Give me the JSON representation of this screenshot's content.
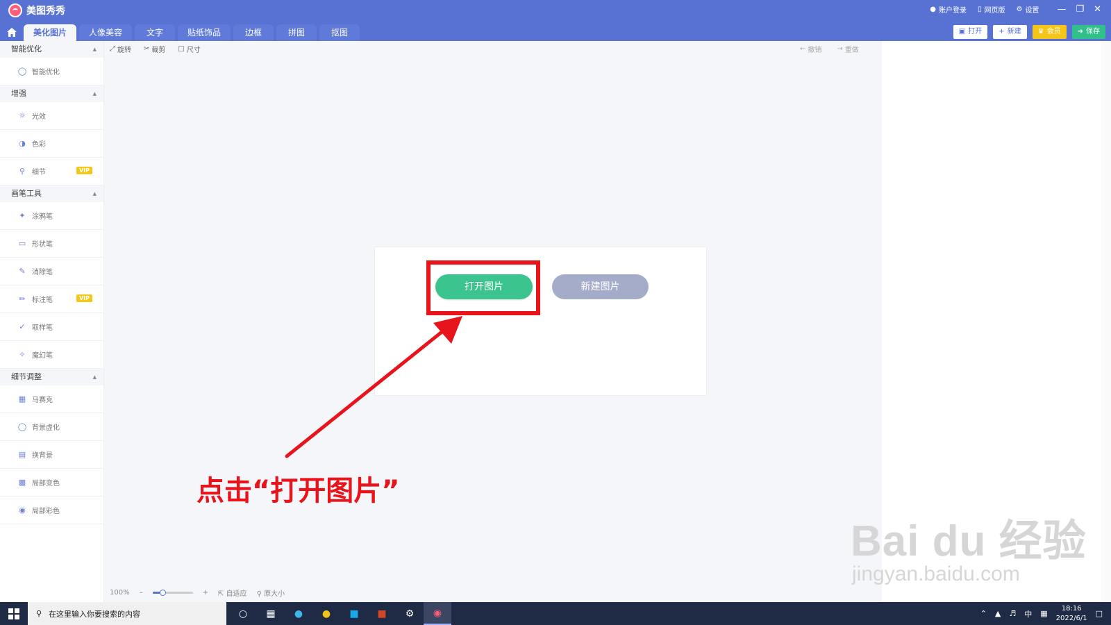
{
  "app": {
    "title": "美图秀秀"
  },
  "top_right": {
    "login": "账户登录",
    "web": "网页版",
    "settings": "设置"
  },
  "tabs": [
    "美化图片",
    "人像美容",
    "文字",
    "贴纸饰品",
    "边框",
    "拼图",
    "抠图"
  ],
  "actions": {
    "open": "打开",
    "new": "新建",
    "vip": "会员",
    "save": "保存"
  },
  "sidebar": {
    "groups": [
      {
        "title": "智能优化",
        "items": [
          {
            "label": "智能优化",
            "icon": "bulb-icon"
          }
        ]
      },
      {
        "title": "增强",
        "items": [
          {
            "label": "光效",
            "icon": "sun-icon"
          },
          {
            "label": "色彩",
            "icon": "palette-icon"
          },
          {
            "label": "细节",
            "icon": "magnifier-icon",
            "badge": "VIP"
          }
        ]
      },
      {
        "title": "画笔工具",
        "items": [
          {
            "label": "涂鸦笔",
            "icon": "brush-icon"
          },
          {
            "label": "形状笔",
            "icon": "shape-icon"
          },
          {
            "label": "消除笔",
            "icon": "eraser-icon"
          },
          {
            "label": "标注笔",
            "icon": "pen-icon",
            "badge": "VIP"
          },
          {
            "label": "取样笔",
            "icon": "dropper-icon"
          },
          {
            "label": "魔幻笔",
            "icon": "magic-pen-icon"
          }
        ]
      },
      {
        "title": "细节调整",
        "items": [
          {
            "label": "马赛克",
            "icon": "mosaic-icon"
          },
          {
            "label": "背景虚化",
            "icon": "blur-icon"
          },
          {
            "label": "换背景",
            "icon": "background-icon"
          },
          {
            "label": "局部变色",
            "icon": "recolor-icon"
          },
          {
            "label": "局部彩色",
            "icon": "partial-color-icon"
          }
        ]
      }
    ]
  },
  "toolbar": {
    "rotate": "旋转",
    "crop": "裁剪",
    "size": "尺寸",
    "undo": "撤销",
    "redo": "重做"
  },
  "dialog": {
    "open_image": "打开图片",
    "new_image": "新建图片"
  },
  "annotation": "点击“打开图片”",
  "status": {
    "zoom": "100%",
    "zoom_fraction": 0.25,
    "fit": "自适应",
    "original": "原大小"
  },
  "watermark": {
    "main": "Bai du 经验",
    "sub": "jingyan.baidu.com"
  },
  "taskbar": {
    "search_placeholder": "在这里输入你要搜索的内容",
    "ime": "中",
    "time": "18:16",
    "date": "2022/6/1"
  },
  "colors": {
    "brand": "#5772d3",
    "open_button": "#3cc48e",
    "new_button": "#a4acc9",
    "highlight": "#e8141b",
    "vip": "#f5c518"
  }
}
